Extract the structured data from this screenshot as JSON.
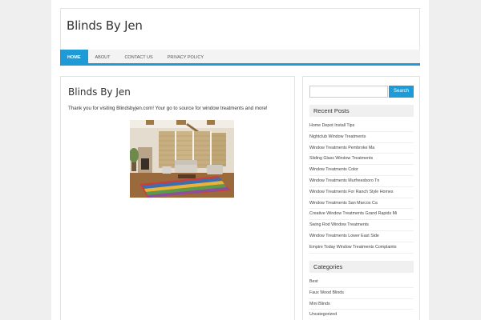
{
  "site": {
    "title": "Blinds By Jen"
  },
  "nav": {
    "items": [
      "Home",
      "About",
      "Contact Us",
      "Privacy Policy"
    ]
  },
  "post": {
    "title": "Blinds By Jen",
    "text": "Thank you for visiting Blindsbyjen.com!  Your go to source for window treatments and more!"
  },
  "search": {
    "value": "",
    "button_label": "Search"
  },
  "recent_posts": {
    "title": "Recent Posts",
    "items": [
      "Home Depot Install Tips",
      "Nightclub Window Treatments",
      "Window Treatments Pembroke Ma",
      "Sliding Glass Window Treatments",
      "Window Treatments Color",
      "Window Treatments Murfreesboro Tn",
      "Window Treatments For Ranch Style Homes",
      "Window Treatments San Marcos Ca",
      "Creative Window Treatments Grand Rapids Mi",
      "Swing Rod Window Treatments",
      "Window Treatments Lower East Side",
      "Empire Today Window Treatments Complaints"
    ]
  },
  "categories": {
    "title": "Categories",
    "items": [
      "Best",
      "Faux Wood Blinds",
      "Mini Blinds",
      "Uncategorized"
    ]
  },
  "colors": {
    "accent": "#1e9bd7",
    "background": "#efefef"
  }
}
